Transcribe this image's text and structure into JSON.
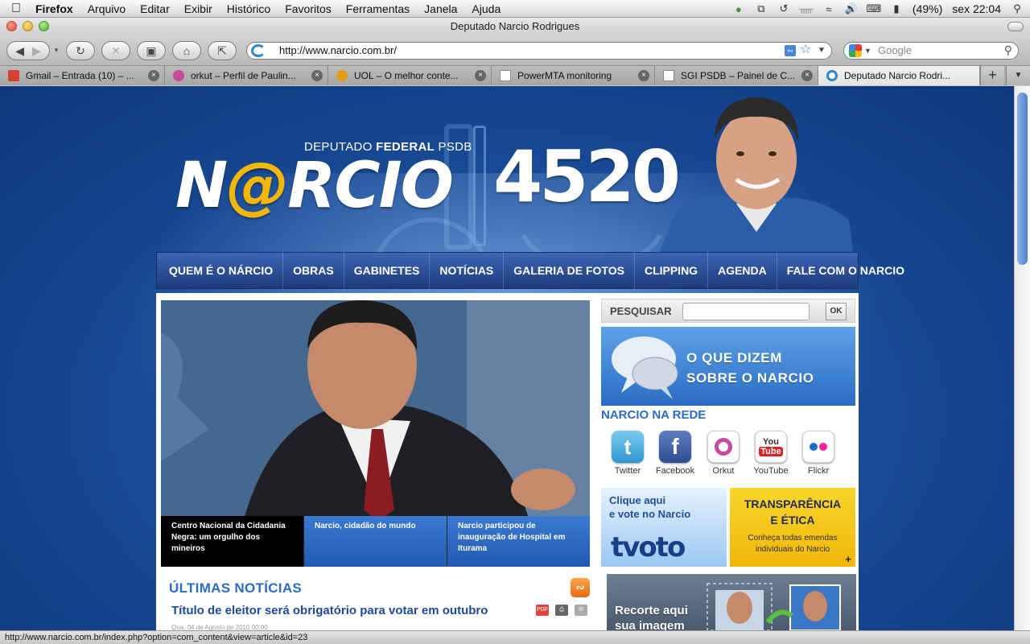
{
  "menubar": {
    "app": "Firefox",
    "items": [
      "Arquivo",
      "Editar",
      "Exibir",
      "Histórico",
      "Favoritos",
      "Ferramentas",
      "Janela",
      "Ajuda"
    ],
    "battery": "(49%)",
    "clock": "sex 22:04"
  },
  "window": {
    "title": "Deputado Narcio Rodrigues"
  },
  "navbar": {
    "url": "http://www.narcio.com.br/",
    "search_placeholder": "Google"
  },
  "tabs": [
    {
      "label": "Gmail – Entrada (10) – ...",
      "color": "#d44133"
    },
    {
      "label": "orkut – Perfil de Paulin...",
      "color": "#c74b9a"
    },
    {
      "label": "UOL – O melhor conte...",
      "color": "#e29d16"
    },
    {
      "label": "PowerMTA monitoring",
      "color": "#ffffff"
    },
    {
      "label": "SGI PSDB – Painel de C...",
      "color": "#ffffff"
    },
    {
      "label": "Deputado Narcio Rodri...",
      "color": "#2b88cc",
      "active": true
    }
  ],
  "site": {
    "logo_sub_pre": "DEPUTADO ",
    "logo_sub_bold": "FEDERAL",
    "logo_sub_post": " PSDB",
    "logo_n": "N",
    "logo_at": "@",
    "logo_rest": "RCIO",
    "number": "4520",
    "nav": [
      "QUEM É O NÁRCIO",
      "OBRAS",
      "GABINETES",
      "NOTÍCIAS",
      "GALERIA DE FOTOS",
      "CLIPPING",
      "AGENDA",
      "FALE COM O NARCIO"
    ],
    "featured_captions": [
      "Centro Nacional da Cidadania Negra: um orgulho dos mineiros",
      "Narcio, cidadão do mundo",
      "Narcio participou de inauguração de Hospital em Iturama"
    ],
    "search_label": "PESQUISAR",
    "search_ok": "OK",
    "banner_line1": "O QUE DIZEM",
    "banner_line2": "SOBRE O NARCIO",
    "network_title": "NARCIO NA REDE",
    "social": [
      {
        "label": "Twitter",
        "color": "#49a8d8",
        "glyph": "t"
      },
      {
        "label": "Facebook",
        "color": "#3a5a9a",
        "glyph": "f"
      },
      {
        "label": "Orkut",
        "color": "#ffffff",
        "glyph": "O"
      },
      {
        "label": "YouTube",
        "color": "#ffffff",
        "glyph": "You"
      },
      {
        "label": "Flickr",
        "color": "#ffffff",
        "glyph": "••"
      }
    ],
    "tvoto_line1": "Clique aqui",
    "tvoto_line2": "e vote no Narcio",
    "tvoto_logo_t": "t",
    "tvoto_logo": "voto",
    "transp_line1": "TRANSPARÊNCIA",
    "transp_line2": "E ÉTICA",
    "transp_desc": "Conheça todas emendas individuais do Narcio",
    "transp_plus": "+",
    "recorte_line1": "Recorte aqui",
    "recorte_line2": "sua imagem",
    "news_title": "ÚLTIMAS NOTÍCIAS",
    "article_title": "Título de eleitor será obrigatório para votar em outubro",
    "article_date": "Qua, 04 de Agosto de 2010 00:00"
  },
  "status": "http://www.narcio.com.br/index.php?option=com_content&view=article&id=23"
}
